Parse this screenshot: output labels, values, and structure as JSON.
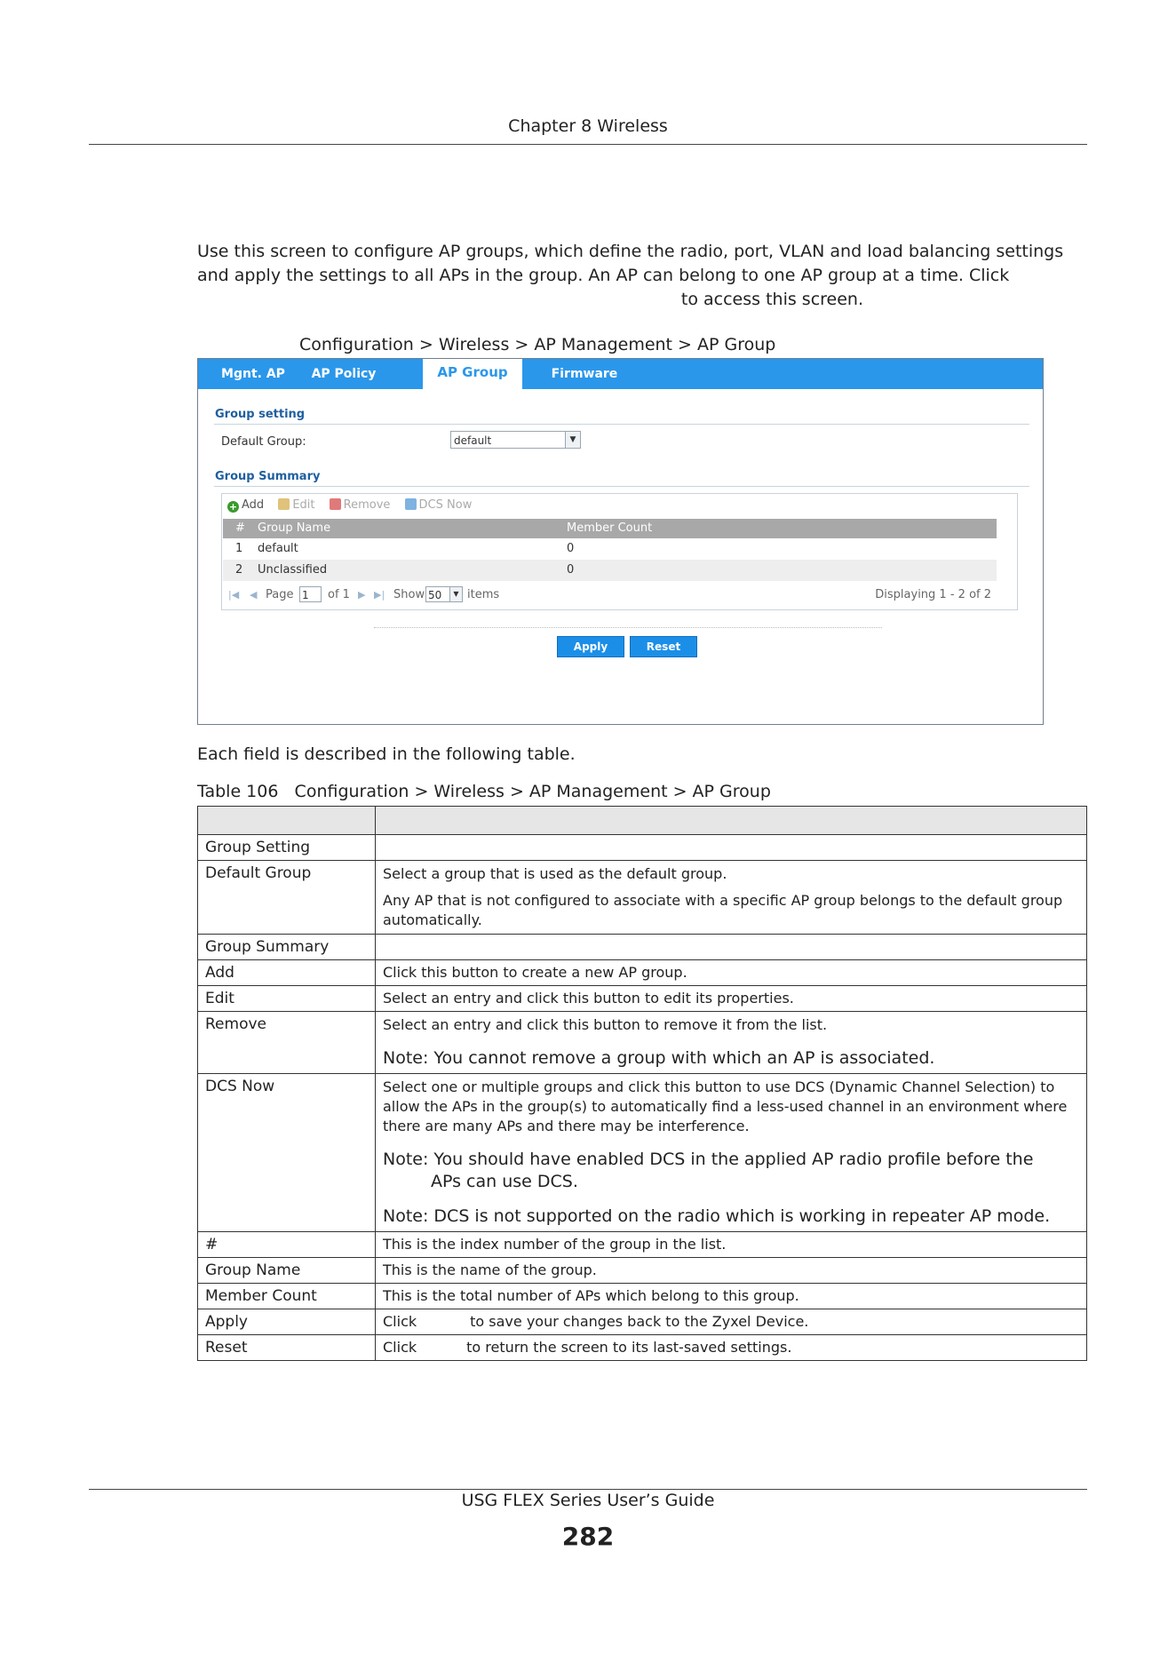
{
  "header": {
    "chapter": "Chapter 8 Wireless"
  },
  "intro": {
    "line1": "Use this screen to configure AP groups, which define the radio, port, VLAN and load balancing settings",
    "line2": "and apply the settings to all APs in the group. An AP can belong to one AP group at a time. Click",
    "line3": "to access this screen."
  },
  "figure_caption": "Configuration > Wireless > AP Management > AP Group",
  "ui": {
    "tabs": [
      {
        "label": "Mgnt. AP List"
      },
      {
        "label": "AP Policy"
      },
      {
        "label": "AP Group"
      },
      {
        "label": "Firmware"
      }
    ],
    "group_setting_label": "Group setting",
    "default_group_label": "Default Group:",
    "default_group_value": "default",
    "group_summary_label": "Group Summary",
    "toolbar": {
      "add": "Add",
      "edit": "Edit",
      "remove": "Remove",
      "dcs_now": "DCS Now"
    },
    "grid": {
      "columns": [
        "#",
        "Group Name",
        "Member Count"
      ],
      "rows": [
        {
          "num": "1",
          "name": "default",
          "count": "0"
        },
        {
          "num": "2",
          "name": "Unclassified",
          "count": "0"
        }
      ]
    },
    "pager": {
      "page_label": "Page",
      "page_value": "1",
      "of_label": "of 1",
      "show_label": "Show",
      "show_value": "50",
      "items_label": "items",
      "displaying": "Displaying 1 - 2 of 2"
    },
    "apply_label": "Apply",
    "reset_label": "Reset"
  },
  "each_field_text": "Each field is described in the following table.",
  "table_caption": "Table 106   Configuration > Wireless > AP Management > AP Group",
  "table": {
    "rows": [
      {
        "label": "Group Setting",
        "desc": ""
      },
      {
        "label": "Default Group",
        "desc1": "Select a group that is used as the default group.",
        "desc2": "Any AP that is not configured to associate with a specific AP group belongs to the default group automatically."
      },
      {
        "label": "Group Summary",
        "desc": ""
      },
      {
        "label": "Add",
        "desc": "Click this button to create a new AP group."
      },
      {
        "label": "Edit",
        "desc": "Select an entry and click this button to edit its properties."
      },
      {
        "label": "Remove",
        "desc": "Select an entry and click this button to remove it from the list.",
        "note": "Note: You cannot remove a group with which an AP is associated."
      },
      {
        "label": "DCS Now",
        "desc": "Select one or multiple groups and click this button to use DCS (Dynamic Channel Selection) to allow the APs in the group(s) to automatically find a less-used channel in an environment where there are many APs and there may be interference.",
        "note1a": "Note: You should have enabled DCS in the applied AP radio profile before the",
        "note1b": "APs can use DCS.",
        "note2": "Note: DCS is not supported on the radio which is working in repeater AP mode."
      },
      {
        "label": "#",
        "desc": "This is the index number of the group in the list."
      },
      {
        "label": "Group Name",
        "desc": "This is the name of the group."
      },
      {
        "label": "Member Count",
        "desc": "This is the total number of APs which belong to this group."
      },
      {
        "label": "Apply",
        "desc_a": "Click",
        "desc_b": "to save your changes back to the Zyxel Device."
      },
      {
        "label": "Reset",
        "desc_a": "Click",
        "desc_b": "to return the screen to its last-saved settings."
      }
    ]
  },
  "footer": {
    "guide": "USG FLEX Series User’s Guide",
    "page": "282"
  }
}
